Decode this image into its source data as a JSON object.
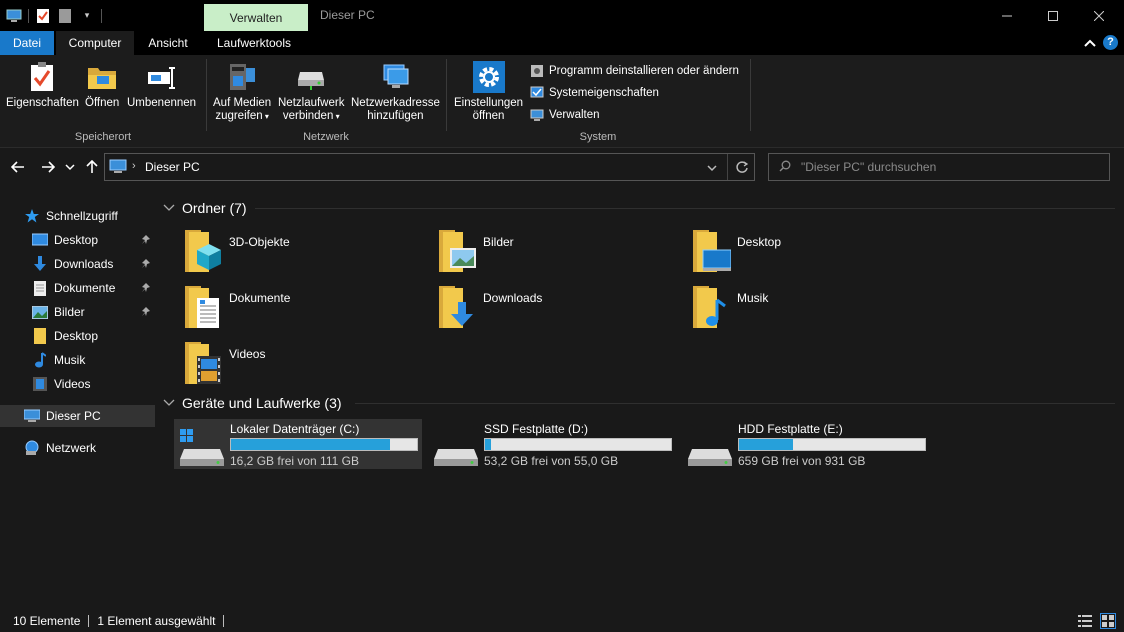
{
  "window": {
    "context_tab": "Verwalten",
    "title": "Dieser PC"
  },
  "tabs": [
    {
      "label": "Datei"
    },
    {
      "label": "Computer"
    },
    {
      "label": "Ansicht"
    },
    {
      "label": "Laufwerktools"
    }
  ],
  "ribbon": {
    "groups": {
      "speicherort": "Speicherort",
      "netzwerk": "Netzwerk",
      "system": "System"
    },
    "buttons": {
      "eigenschaften": "Eigenschaften",
      "oeffnen": "Öffnen",
      "umbenennen": "Umbenennen",
      "auf_medien_1": "Auf Medien",
      "auf_medien_2": "zugreifen",
      "netzlaufwerk_1": "Netzlaufwerk",
      "netzlaufwerk_2": "verbinden",
      "netzwerkadresse_1": "Netzwerkadresse",
      "netzwerkadresse_2": "hinzufügen",
      "einstellungen_1": "Einstellungen",
      "einstellungen_2": "öffnen"
    },
    "system_items": [
      "Programm deinstallieren oder ändern",
      "Systemeigenschaften",
      "Verwalten"
    ]
  },
  "address": {
    "path": "Dieser PC",
    "search_placeholder": "\"Dieser PC\" durchsuchen"
  },
  "nav": {
    "schnellzugriff": "Schnellzugriff",
    "items": [
      "Desktop",
      "Downloads",
      "Dokumente",
      "Bilder",
      "Desktop",
      "Musik",
      "Videos"
    ],
    "dieser_pc": "Dieser PC",
    "netzwerk": "Netzwerk"
  },
  "folders_group": "Ordner (7)",
  "folders": [
    "3D-Objekte",
    "Bilder",
    "Desktop",
    "Dokumente",
    "Downloads",
    "Musik",
    "Videos"
  ],
  "drives_group": "Geräte und Laufwerke (3)",
  "drives": [
    {
      "name": "Lokaler Datenträger (C:)",
      "free": "16,2 GB frei von 111 GB",
      "used_fraction": 0.854
    },
    {
      "name": "SSD Festplatte (D:)",
      "free": "53,2 GB frei von 55,0 GB",
      "used_fraction": 0.033
    },
    {
      "name": "HDD Festplatte (E:)",
      "free": "659 GB frei von 931 GB",
      "used_fraction": 0.292
    }
  ],
  "status": {
    "count": "10 Elemente",
    "selected": "1 Element ausgewählt"
  },
  "colors": {
    "accent": "#1979ca",
    "context_tab": "#c9eec8",
    "drive_bar": "#26a0da",
    "folder": "#e8c266"
  }
}
